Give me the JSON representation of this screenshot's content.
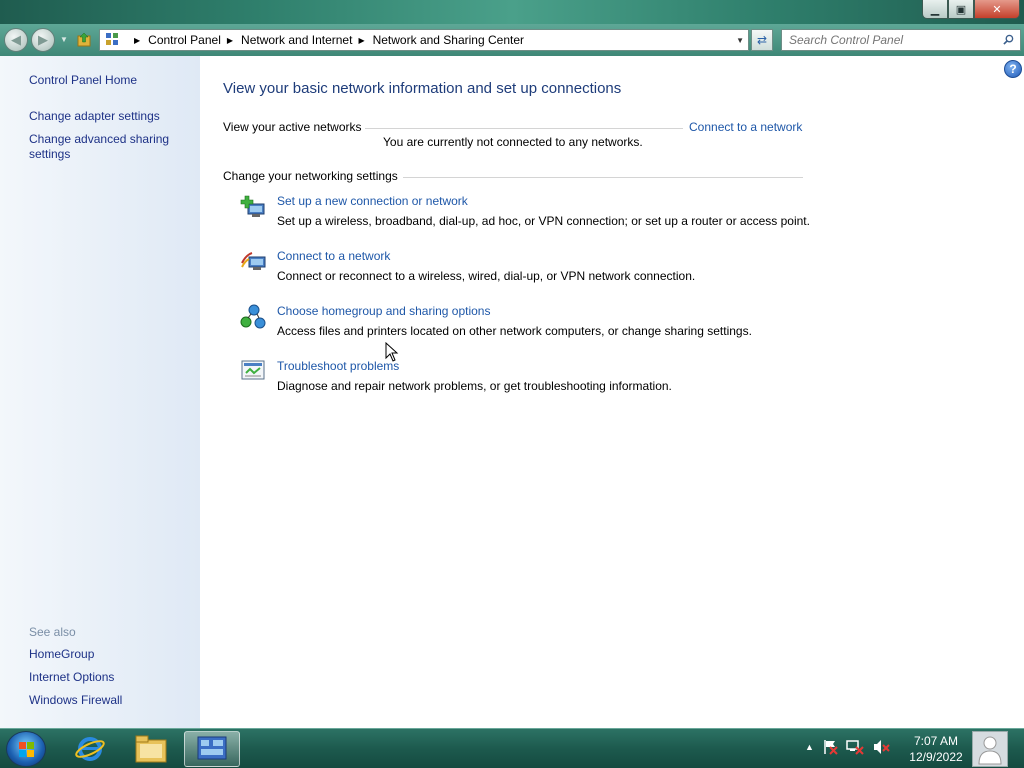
{
  "window": {
    "controls": {
      "minimize": "▁",
      "maximize": "▣",
      "close": "✕"
    }
  },
  "address_bar": {
    "crumbs": [
      "Control Panel",
      "Network and Internet",
      "Network and Sharing Center"
    ]
  },
  "search": {
    "placeholder": "Search Control Panel"
  },
  "sidebar": {
    "home": "Control Panel Home",
    "links": [
      "Change adapter settings",
      "Change advanced sharing settings"
    ],
    "see_also_label": "See also",
    "see_also": [
      "HomeGroup",
      "Internet Options",
      "Windows Firewall"
    ]
  },
  "main": {
    "title": "View your basic network information and set up connections",
    "active_networks_label": "View your active networks",
    "connect_link": "Connect to a network",
    "not_connected": "You are currently not connected to any networks.",
    "change_settings_label": "Change your networking settings",
    "tasks": [
      {
        "title": "Set up a new connection or network",
        "desc": "Set up a wireless, broadband, dial-up, ad hoc, or VPN connection; or set up a router or access point.",
        "icon": "new-connection-icon"
      },
      {
        "title": "Connect to a network",
        "desc": "Connect or reconnect to a wireless, wired, dial-up, or VPN network connection.",
        "icon": "connect-network-icon"
      },
      {
        "title": "Choose homegroup and sharing options",
        "desc": "Access files and printers located on other network computers, or change sharing settings.",
        "icon": "homegroup-icon"
      },
      {
        "title": "Troubleshoot problems",
        "desc": "Diagnose and repair network problems, or get troubleshooting information.",
        "icon": "troubleshoot-icon"
      }
    ]
  },
  "taskbar": {
    "time": "7:07 AM",
    "date": "12/9/2022",
    "tray_arrow": "▲"
  },
  "colors": {
    "link": "#1e57a8",
    "title": "#1e3c7a",
    "sidebar_link": "#1e3287"
  }
}
